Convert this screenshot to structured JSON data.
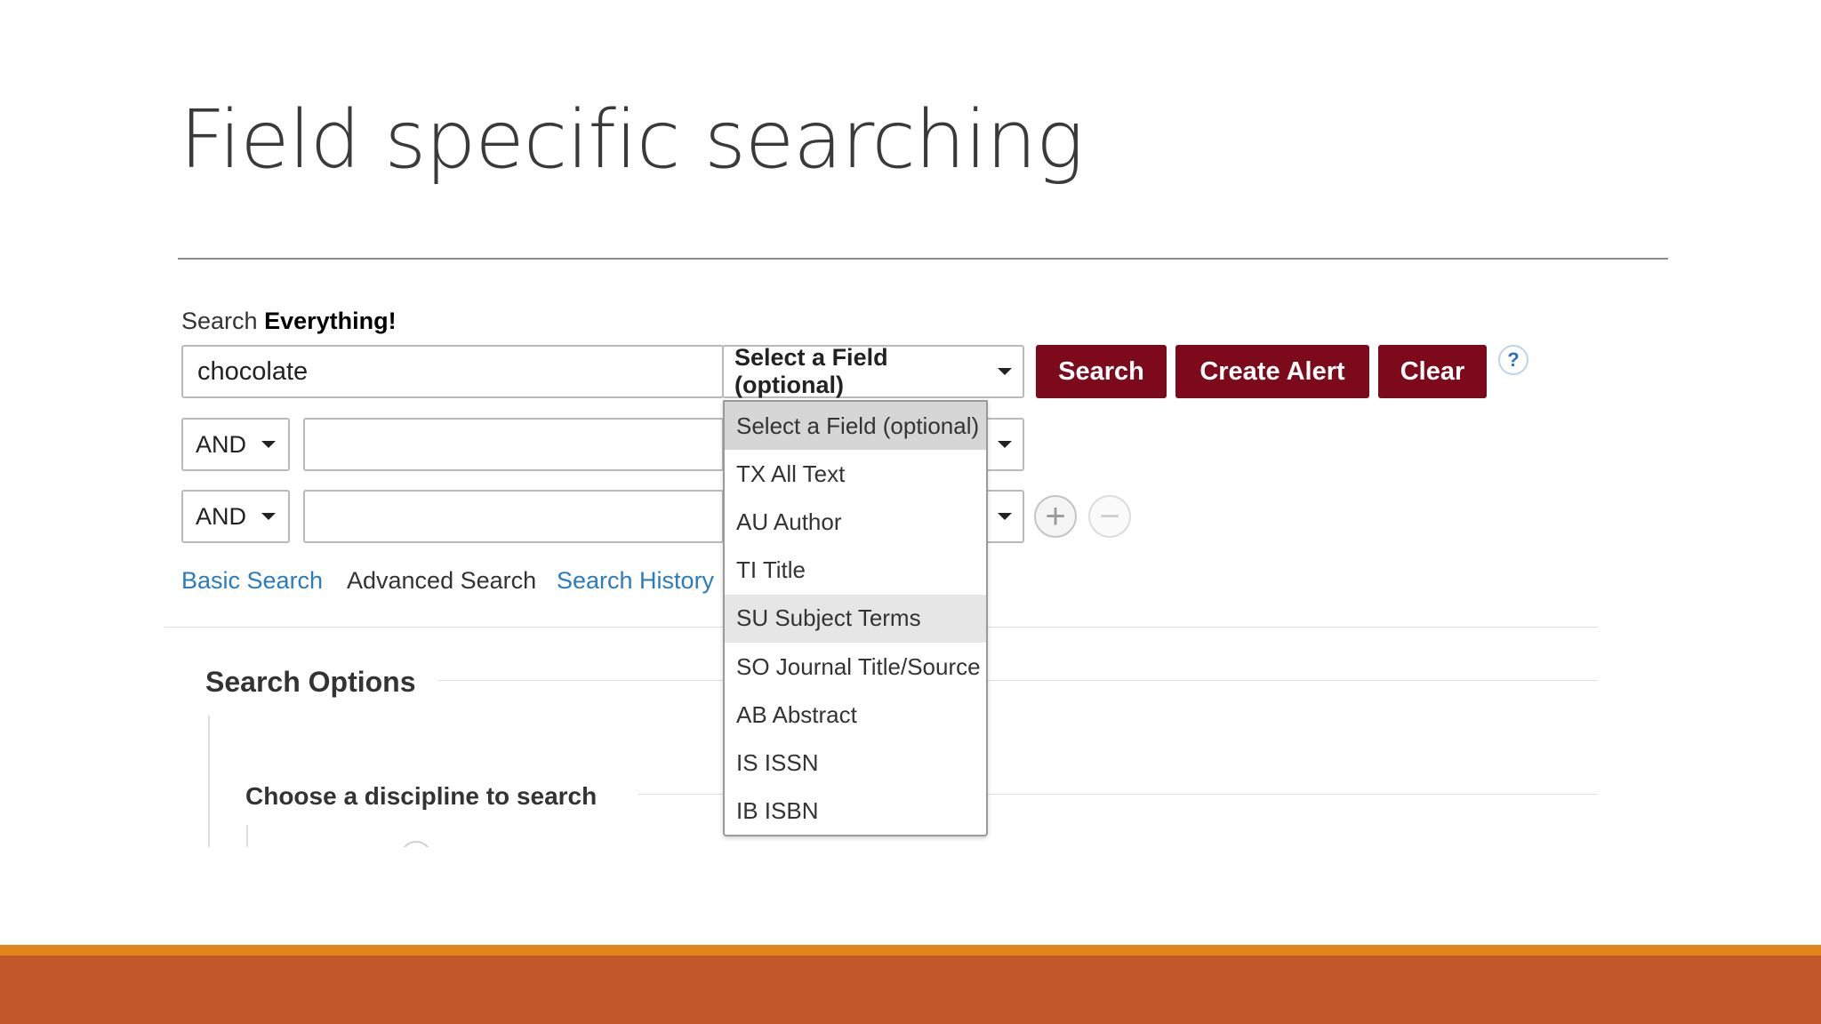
{
  "slide": {
    "title": "Field specific searching"
  },
  "search": {
    "label_prefix": "Search ",
    "label_bold": "Everything!",
    "query_value": "chocolate",
    "field_select_label": "Select a Field (optional)",
    "rows": [
      {
        "bool_op": "AND"
      },
      {
        "bool_op": "AND"
      }
    ]
  },
  "buttons": {
    "search": "Search",
    "create_alert": "Create Alert",
    "clear": "Clear",
    "help": "?",
    "add_row": "+",
    "remove_row": "−"
  },
  "links": {
    "basic_search": "Basic Search",
    "advanced_search": "Advanced Search",
    "search_history": "Search History"
  },
  "options": {
    "title": "Search Options",
    "discipline_title": "Choose a discipline to search"
  },
  "dropdown": {
    "highlighted_index": 4,
    "items": [
      "Select a Field (optional)",
      "TX All Text",
      "AU Author",
      "TI Title",
      "SU Subject Terms",
      "SO Journal Title/Source",
      "AB Abstract",
      "IS ISSN",
      "IB ISBN"
    ]
  },
  "colors": {
    "button_bg": "#7c0a1b",
    "link": "#2b7bbf",
    "footer_orange": "#e0861c",
    "footer_brown": "#c1572a"
  },
  "icons": {
    "caret": "chevron-down-icon",
    "help": "help-icon",
    "add": "plus-icon",
    "remove": "minus-icon"
  }
}
